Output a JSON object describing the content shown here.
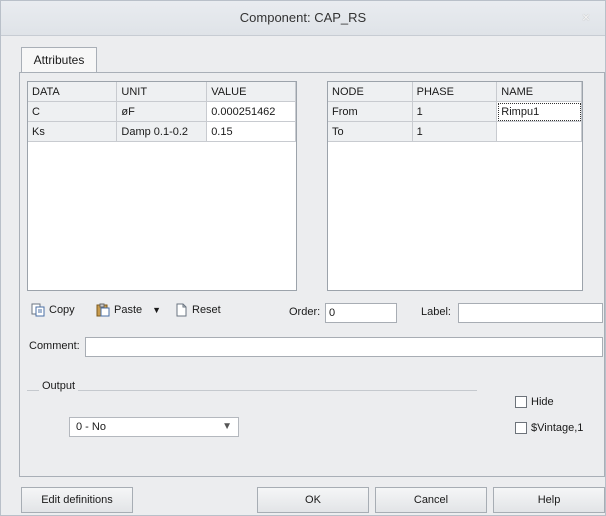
{
  "window": {
    "title": "Component: CAP_RS",
    "close_glyph": "×"
  },
  "tabs": [
    {
      "label": "Attributes"
    }
  ],
  "data_table": {
    "headers": [
      "DATA",
      "UNIT",
      "VALUE"
    ],
    "rows": [
      [
        "C",
        "øF",
        "0.000251462"
      ],
      [
        "Ks",
        "Damp 0.1-0.2",
        "0.15"
      ]
    ]
  },
  "node_table": {
    "headers": [
      "NODE",
      "PHASE",
      "NAME"
    ],
    "rows": [
      [
        "From",
        "1",
        "Rimpu1"
      ],
      [
        "To",
        "1",
        ""
      ]
    ]
  },
  "toolbar": {
    "copy": "Copy",
    "paste": "Paste",
    "reset": "Reset"
  },
  "order": {
    "label": "Order:",
    "value": "0"
  },
  "label_field": {
    "label": "Label:",
    "value": ""
  },
  "comment": {
    "label": "Comment:",
    "value": ""
  },
  "output": {
    "group_label": "Output",
    "selected": "0 - No"
  },
  "checks": {
    "hide": "Hide",
    "vintage": "$Vintage,1"
  },
  "buttons": {
    "edit_definitions": "Edit definitions",
    "ok": "OK",
    "cancel": "Cancel",
    "help": "Help"
  },
  "icons": {
    "copy": "copy-icon",
    "paste": "paste-icon",
    "reset": "reset-icon",
    "close": "close-icon",
    "dropdown": "chevron-down-icon"
  }
}
